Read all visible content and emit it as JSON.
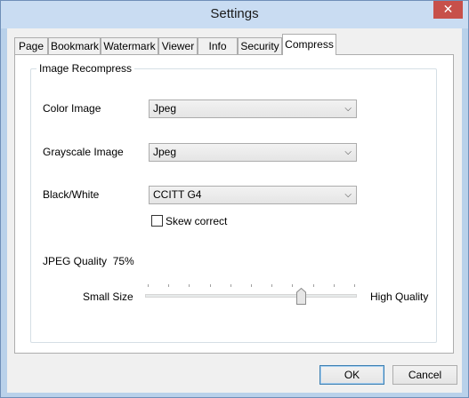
{
  "window": {
    "title": "Settings",
    "close_glyph": "✕"
  },
  "tabs": [
    {
      "label": "Page"
    },
    {
      "label": "Bookmark"
    },
    {
      "label": "Watermark"
    },
    {
      "label": "Viewer"
    },
    {
      "label": "Info"
    },
    {
      "label": "Security"
    },
    {
      "label": "Compress",
      "active": true
    }
  ],
  "group": {
    "title": "Image Recompress",
    "color_image": {
      "label": "Color Image",
      "value": "Jpeg"
    },
    "grayscale_image": {
      "label": "Grayscale Image",
      "value": "Jpeg"
    },
    "black_white": {
      "label": "Black/White",
      "value": "CCITT G4"
    },
    "skew_correct": {
      "label": "Skew correct",
      "checked": false
    },
    "jpeg_quality": {
      "label": "JPEG Quality",
      "value_text": "75%",
      "value": 75,
      "min_label": "Small Size",
      "max_label": "High Quality"
    }
  },
  "buttons": {
    "ok": "OK",
    "cancel": "Cancel"
  },
  "icons": {
    "dropdown": "chevron-down-icon",
    "close": "close-icon",
    "slider_thumb": "slider-thumb-icon"
  },
  "colors": {
    "title_bar": "#c9dcf2",
    "close_button": "#c7504a",
    "default_button_border": "#3c7fb1"
  }
}
